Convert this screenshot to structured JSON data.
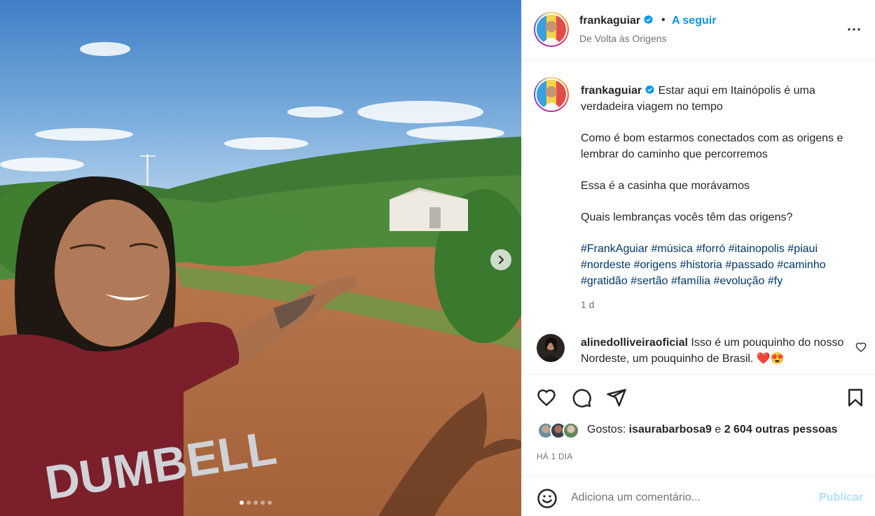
{
  "post": {
    "image_alt": "Foto: homem de camiseta vinho apontando para uma casinha branca no sertão",
    "shirt_text": "DUMBELL",
    "carousel": {
      "total": 5,
      "active": 0
    }
  },
  "header": {
    "username": "frankaguiar",
    "bullet": "•",
    "follow_label": "A seguir",
    "location": "De Volta às Origens"
  },
  "caption": {
    "username": "frankaguiar",
    "line1": "Estar aqui em Itainópolis é uma verdadeira viagem no tempo",
    "line2": "Como é bom estarmos conectados com as origens e lembrar do caminho que percorremos",
    "line3": "Essa é a casinha que morávamos",
    "line4": "Quais lembranças vocês têm das origens?",
    "hashtags": [
      "#FrankAguiar",
      "#música",
      "#forró",
      "#itainopolis",
      "#piaui",
      "#nordeste",
      "#origens",
      "#historia",
      "#passado",
      "#caminho",
      "#gratidão",
      "#sertão",
      "#família",
      "#evolução",
      "#fy"
    ],
    "time": "1 d"
  },
  "comment": {
    "username": "alinedolliveiraoficial",
    "text": "Isso é um pouquinho do nosso Nordeste, um pouquinho de Brasil. ❤️😍"
  },
  "likes": {
    "prefix": "Gostos:",
    "first_user": "isaurabarbosa9",
    "connector": "e",
    "others": "2 604 outras pessoas"
  },
  "date": "HÁ 1 DIA",
  "add_comment": {
    "placeholder": "Adiciona um comentário...",
    "publish_label": "Publicar"
  },
  "colors": {
    "accent_blue": "#0095f6",
    "hashtag": "#00376b",
    "publish_disabled": "#b2dffc",
    "verified": "#0095f6",
    "heart_red": "#ed4956"
  },
  "icons": [
    "like-icon",
    "comment-icon",
    "share-icon",
    "save-icon",
    "emoji-icon",
    "more-options-icon",
    "verified-badge-icon",
    "chevron-right-icon",
    "comment-like-icon"
  ]
}
